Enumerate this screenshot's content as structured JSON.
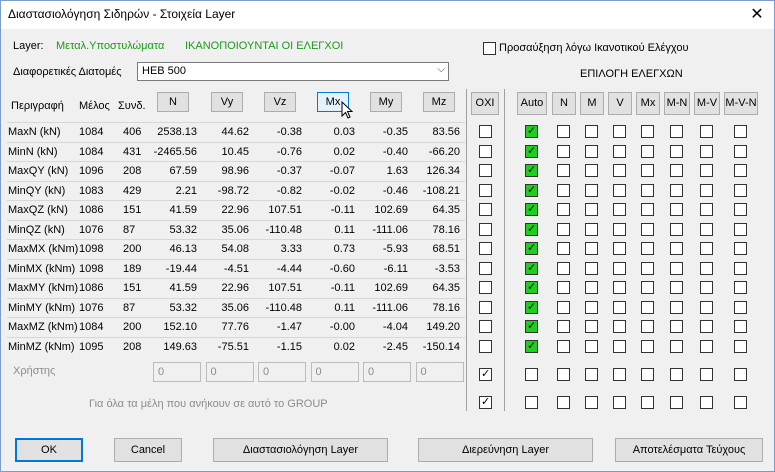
{
  "window": {
    "title": "Διαστασιολόγηση Σιδηρών - Στοιχεία Layer",
    "close": "✕"
  },
  "layer": {
    "label": "Layer:",
    "name": "Μεταλ.Υποστυλώματα",
    "status": "ΙΚΑΝΟΠΟΙΟΥΝΤΑΙ ΟΙ ΕΛΕΓΧΟΙ"
  },
  "increase_checkbox": {
    "label": "Προσαύξηση λόγω Ικανοτικού Ελέγχου",
    "checked": false
  },
  "sections": {
    "label": "Διαφορετικές Διατομές",
    "selected": "HEB 500"
  },
  "checks_title": "ΕΠΙΛΟΓΗ ΕΛΕΓΧΩΝ",
  "columns": {
    "desc": "Περιγραφή",
    "member": "Μέλος",
    "combo": "Συνδ."
  },
  "force_buttons": [
    "N",
    "Vy",
    "Vz",
    "Mx",
    "My",
    "Mz"
  ],
  "oxi_button": "ΟΧΙ",
  "check_buttons": [
    "Auto",
    "N",
    "M",
    "V",
    "Mx",
    "M-N",
    "M-V",
    "M-V-N"
  ],
  "rows": [
    {
      "desc": "MaxN (kN)",
      "member": "1084",
      "combo": "406",
      "vals": [
        "2538.13",
        "44.62",
        "-0.38",
        "0.03",
        "-0.35",
        "83.56"
      ]
    },
    {
      "desc": "MinN (kN)",
      "member": "1084",
      "combo": "431",
      "vals": [
        "-2465.56",
        "10.45",
        "-0.76",
        "0.02",
        "-0.40",
        "-66.20"
      ]
    },
    {
      "desc": "MaxQY (kN)",
      "member": "1096",
      "combo": "208",
      "vals": [
        "67.59",
        "98.96",
        "-0.37",
        "-0.07",
        "1.63",
        "126.34"
      ]
    },
    {
      "desc": "MinQY (kN)",
      "member": "1083",
      "combo": "429",
      "vals": [
        "2.21",
        "-98.72",
        "-0.82",
        "-0.02",
        "-0.46",
        "-108.21"
      ]
    },
    {
      "desc": "MaxQZ (kN)",
      "member": "1086",
      "combo": "151",
      "vals": [
        "41.59",
        "22.96",
        "107.51",
        "-0.11",
        "102.69",
        "64.35"
      ]
    },
    {
      "desc": "MinQZ (kN)",
      "member": "1076",
      "combo": "87",
      "vals": [
        "53.32",
        "35.06",
        "-110.48",
        "0.11",
        "-111.06",
        "78.16"
      ]
    },
    {
      "desc": "MaxMX (kNm)",
      "member": "1098",
      "combo": "200",
      "vals": [
        "46.13",
        "54.08",
        "3.33",
        "0.73",
        "-5.93",
        "68.51"
      ]
    },
    {
      "desc": "MinMX (kNm)",
      "member": "1098",
      "combo": "189",
      "vals": [
        "-19.44",
        "-4.51",
        "-4.44",
        "-0.60",
        "-6.11",
        "-3.53"
      ]
    },
    {
      "desc": "MaxMY (kNm)",
      "member": "1086",
      "combo": "151",
      "vals": [
        "41.59",
        "22.96",
        "107.51",
        "-0.11",
        "102.69",
        "64.35"
      ]
    },
    {
      "desc": "MinMY (kNm)",
      "member": "1076",
      "combo": "87",
      "vals": [
        "53.32",
        "35.06",
        "-110.48",
        "0.11",
        "-111.06",
        "78.16"
      ]
    },
    {
      "desc": "MaxMZ (kNm)",
      "member": "1084",
      "combo": "200",
      "vals": [
        "152.10",
        "77.76",
        "-1.47",
        "-0.00",
        "-4.04",
        "149.20"
      ]
    },
    {
      "desc": "MinMZ (kNm)",
      "member": "1095",
      "combo": "208",
      "vals": [
        "149.63",
        "-75.51",
        "-1.15",
        "0.02",
        "-2.45",
        "-150.14"
      ]
    }
  ],
  "user_row": {
    "label": "Χρήστης",
    "inputs": [
      "0",
      "0",
      "0",
      "0",
      "0",
      "0"
    ],
    "oxi_checked": true
  },
  "group_row": {
    "label": "Για όλα τα μέλη που ανήκουν σε αυτό το GROUP",
    "oxi_checked": true
  },
  "bottom_buttons": {
    "ok": "OK",
    "cancel": "Cancel",
    "design": "Διαστασιολόγηση Layer",
    "investigate": "Διερεύνηση Layer",
    "results": "Αποτελέσματα Τεύχους"
  },
  "colors": {
    "status_green": "#1a9a1a",
    "checkbox_green": "#22cc22",
    "focus_blue": "#0078d7"
  }
}
